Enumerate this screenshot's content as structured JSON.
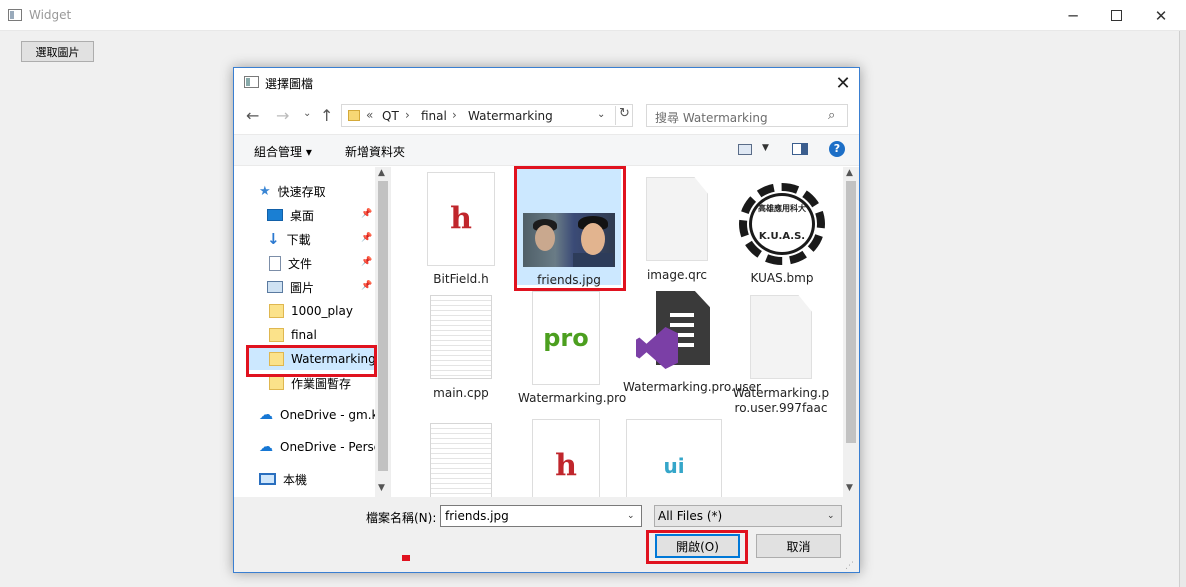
{
  "window": {
    "title": "Widget",
    "min": "─",
    "close": "✕"
  },
  "main": {
    "select_button": "選取圖片"
  },
  "dialog": {
    "title": "選擇圖檔",
    "close": "✕",
    "nav": {
      "back": "←",
      "forward": "→",
      "recent": "⌄",
      "up": "↑"
    },
    "address": {
      "overflow": "«",
      "segments": [
        "QT",
        "final",
        "Watermarking"
      ],
      "separator": "›",
      "dropdown": "⌄",
      "refresh": "↻"
    },
    "search": {
      "placeholder": "搜尋 Watermarking",
      "icon": "⌕"
    },
    "toolbar": {
      "organize": "組合管理 ▾",
      "new_folder": "新增資料夾",
      "view_dropdown": "▼",
      "help": "?"
    },
    "nav_pane": [
      {
        "label": "快速存取",
        "icon": "star-icon"
      },
      {
        "label": "桌面",
        "icon": "desktop-icon",
        "pinned": true
      },
      {
        "label": "下載",
        "icon": "download-icon",
        "pinned": true
      },
      {
        "label": "文件",
        "icon": "document-icon",
        "pinned": true
      },
      {
        "label": "圖片",
        "icon": "picture-icon",
        "pinned": true
      },
      {
        "label": "1000_play",
        "icon": "folder-icon"
      },
      {
        "label": "final",
        "icon": "folder-icon"
      },
      {
        "label": "Watermarking",
        "icon": "folder-icon",
        "selected": true
      },
      {
        "label": "作業圖暫存",
        "icon": "folder-icon"
      },
      {
        "label": "OneDrive - gm.kuas.edu.tw",
        "icon": "cloud-icon"
      },
      {
        "label": "OneDrive - Personal",
        "icon": "cloud-icon"
      },
      {
        "label": "本機",
        "icon": "computer-icon"
      }
    ],
    "files": [
      {
        "name": "BitField.h",
        "type": "h"
      },
      {
        "name": "friends.jpg",
        "type": "photo",
        "selected": true
      },
      {
        "name": "image.qrc",
        "type": "plain"
      },
      {
        "name": "KUAS.bmp",
        "type": "kuas",
        "logo_top": "高雄應用科大",
        "logo_text": "K.U.A.S."
      },
      {
        "name": "main.cpp",
        "type": "lines"
      },
      {
        "name": "Watermarking.pro",
        "type": "pro",
        "glyph": "pro"
      },
      {
        "name": "Watermarking.pro.user",
        "type": "vs"
      },
      {
        "name": "Watermarking.pro.user.997faac",
        "type": "plain"
      },
      {
        "name": "",
        "type": "lines"
      },
      {
        "name": "",
        "type": "h"
      },
      {
        "name": "",
        "type": "ui",
        "glyph": "ui"
      }
    ],
    "file_glyph_h": "h",
    "filename_label": "檔案名稱(N):",
    "filename_value": "friends.jpg",
    "filetype_value": "All Files  (*)",
    "dropdown_arrow": "⌄",
    "open_button": "開啟(O)",
    "cancel_button": "取消",
    "pin_glyph": "📌",
    "scroll_up": "▲",
    "scroll_down": "▼",
    "grip": "⋰"
  },
  "colors": {
    "highlight": "#e0121f",
    "selection": "#cce8ff",
    "dialog_border": "#3a7fd1"
  }
}
